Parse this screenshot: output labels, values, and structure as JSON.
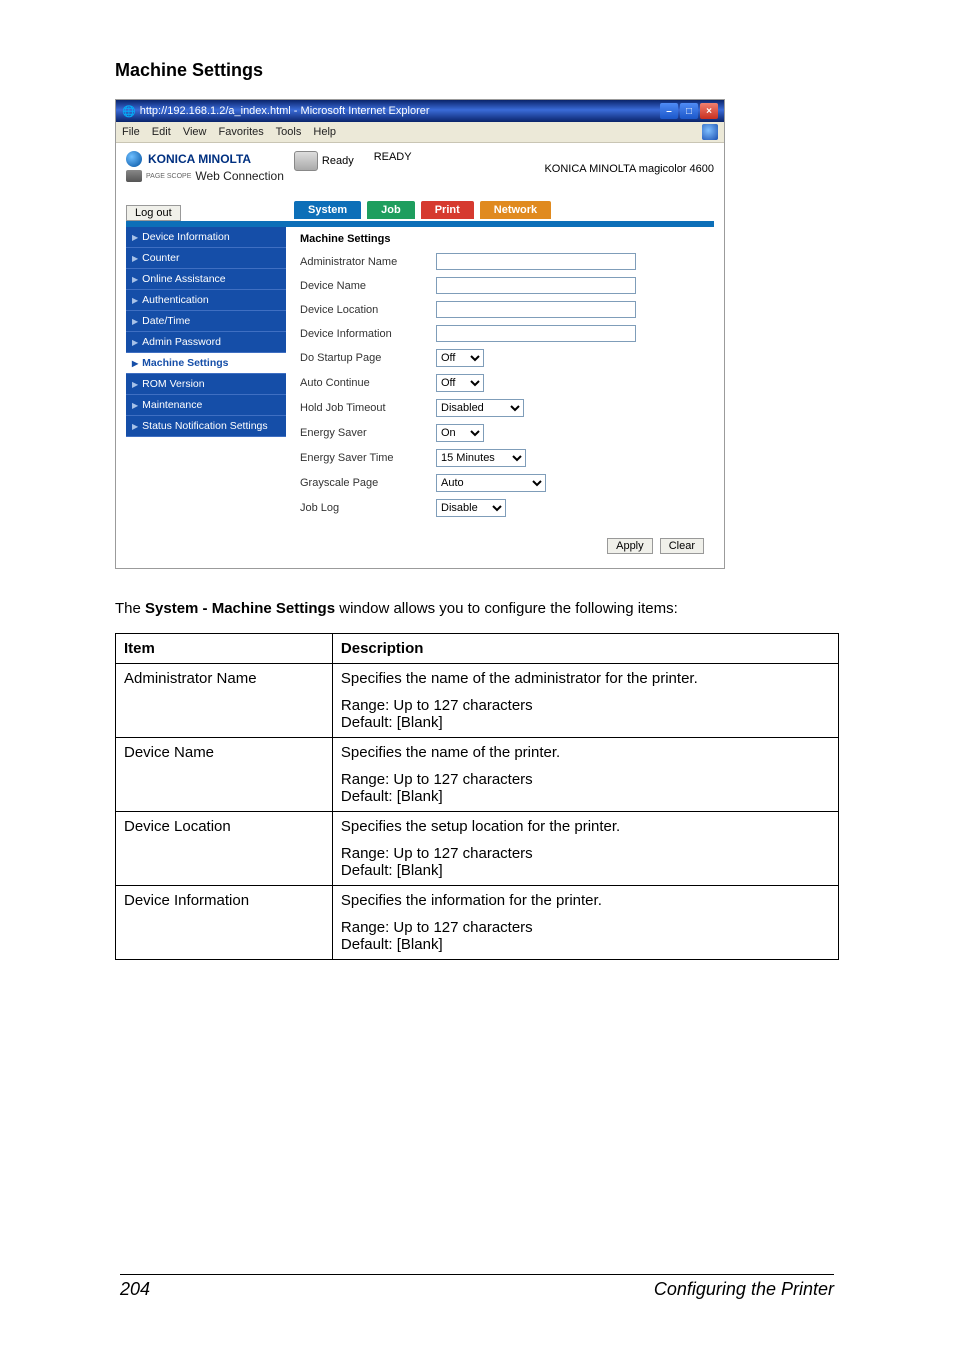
{
  "heading": "Machine Settings",
  "ie": {
    "title": "http://192.168.1.2/a_index.html - Microsoft Internet Explorer",
    "menu": [
      "File",
      "Edit",
      "View",
      "Favorites",
      "Tools",
      "Help"
    ]
  },
  "brand": {
    "company": "KONICA MINOLTA",
    "sub_prefix": "PAGE SCOPE",
    "sub": "Web Connection",
    "status_label": "Ready",
    "status_big": "READY",
    "model": "KONICA MINOLTA magicolor 4600"
  },
  "logout": "Log out",
  "tabs": {
    "system": "System",
    "job": "Job",
    "print": "Print",
    "network": "Network"
  },
  "sidebar": [
    "Device Information",
    "Counter",
    "Online Assistance",
    "Authentication",
    "Date/Time",
    "Admin Password",
    "Machine Settings",
    "ROM Version",
    "Maintenance",
    "Status Notification Settings"
  ],
  "form_title": "Machine Settings",
  "form": {
    "admin_name": {
      "label": "Administrator Name",
      "value": ""
    },
    "device_name": {
      "label": "Device Name",
      "value": ""
    },
    "device_location": {
      "label": "Device Location",
      "value": ""
    },
    "device_info": {
      "label": "Device Information",
      "value": ""
    },
    "startup": {
      "label": "Do Startup Page",
      "value": "Off"
    },
    "auto_continue": {
      "label": "Auto Continue",
      "value": "Off"
    },
    "hold_job": {
      "label": "Hold Job Timeout",
      "value": "Disabled"
    },
    "energy_saver": {
      "label": "Energy Saver",
      "value": "On"
    },
    "energy_saver_time": {
      "label": "Energy Saver Time",
      "value": "15 Minutes"
    },
    "grayscale": {
      "label": "Grayscale Page",
      "value": "Auto"
    },
    "job_log": {
      "label": "Job Log",
      "value": "Disable"
    }
  },
  "buttons": {
    "apply": "Apply",
    "clear": "Clear"
  },
  "para_pre": "The ",
  "para_bold": "System - Machine Settings",
  "para_post": " window allows you to configure the following items:",
  "tableHead": {
    "item": "Item",
    "desc": "Description"
  },
  "rows": [
    {
      "item": "Administrator Name",
      "desc": "Specifies the name of the administrator for the printer.",
      "range": "Range:   Up to 127 characters",
      "default": "Default:  [Blank]"
    },
    {
      "item": "Device Name",
      "desc": "Specifies the name of the printer.",
      "range": "Range:   Up to 127 characters",
      "default": "Default:  [Blank]"
    },
    {
      "item": "Device Location",
      "desc": "Specifies the setup location for the printer.",
      "range": "Range:   Up to 127 characters",
      "default": "Default:  [Blank]"
    },
    {
      "item": "Device Information",
      "desc": "Specifies the information for the printer.",
      "range": "Range:   Up to 127 characters",
      "default": "Default:  [Blank]"
    }
  ],
  "footer": {
    "page": "204",
    "section": "Configuring the Printer"
  }
}
